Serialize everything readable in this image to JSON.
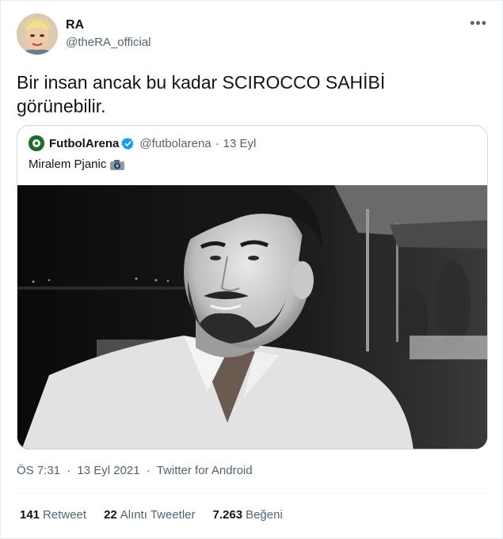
{
  "author": {
    "name": "RA",
    "handle": "@theRA_official"
  },
  "tweet": {
    "text_line1": "Bir insan ancak bu kadar SCIROCCO SAHİBİ",
    "text_line2": "görünebilir."
  },
  "quoted": {
    "name": "FutbolArena",
    "handle": "@futbolarena",
    "separator": "·",
    "date": "13 Eyl",
    "text": "Miralem Pjanic",
    "emoji_icon": "camera-flash-icon",
    "verified_color": "#1d9bf0"
  },
  "meta": {
    "time": "ÖS 7:31",
    "separator1": "·",
    "date": "13 Eyl 2021",
    "separator2": "·",
    "source": "Twitter for Android"
  },
  "stats": {
    "retweets_count": "141",
    "retweets_label": "Retweet",
    "quotes_count": "22",
    "quotes_label": "Alıntı Tweetler",
    "likes_count": "7.263",
    "likes_label": "Beğeni"
  },
  "colors": {
    "text_primary": "#0f1419",
    "text_secondary": "#536471",
    "border": "#cfd9de",
    "accent": "#1d9bf0"
  }
}
